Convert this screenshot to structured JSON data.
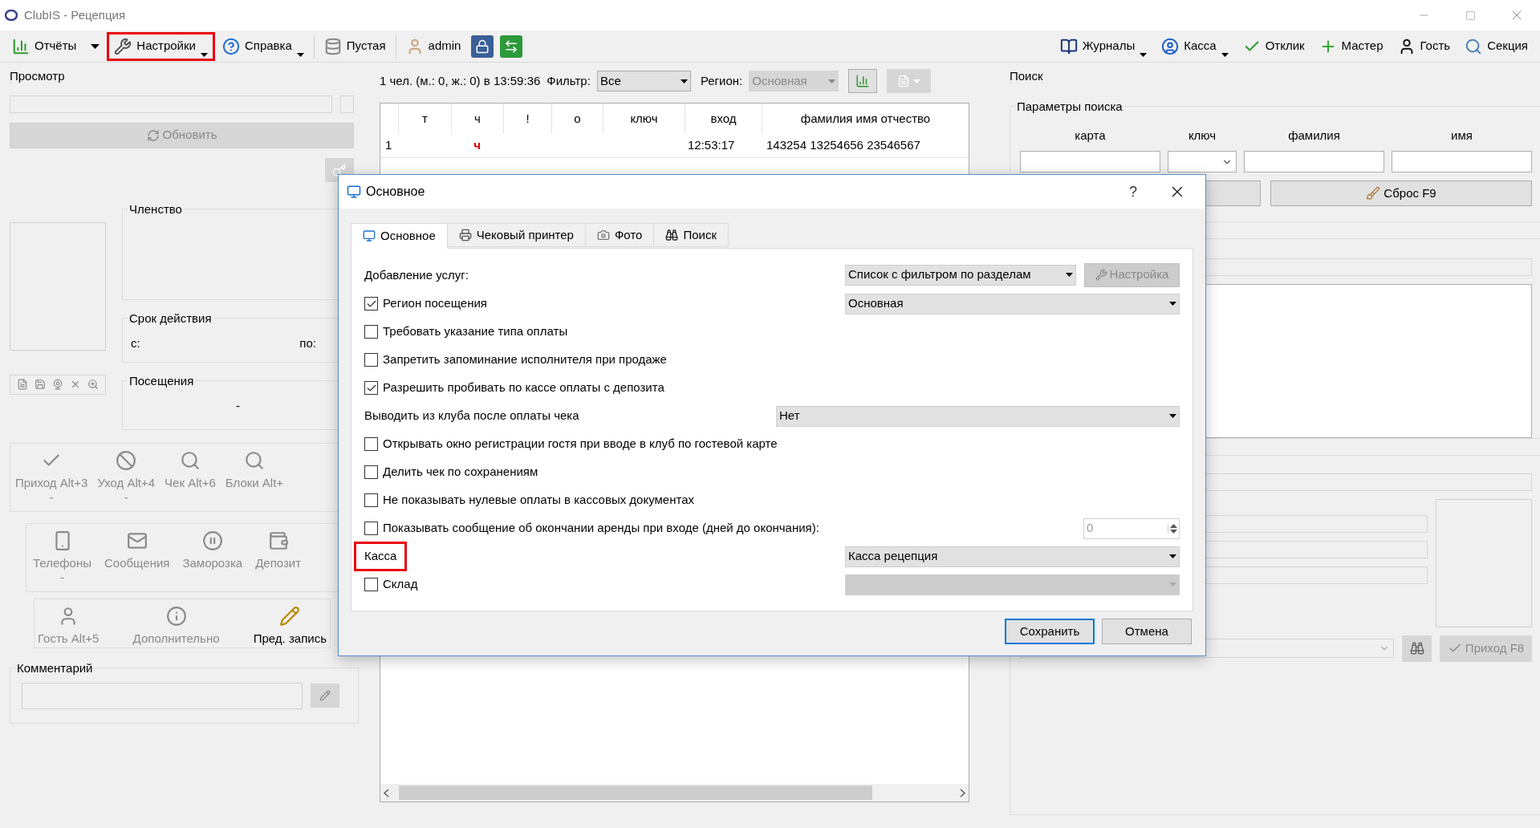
{
  "window": {
    "title": "ClubIS - Рецепция"
  },
  "toolbar_left": [
    {
      "label": "Отчёты",
      "kind": "split",
      "highlighted": false
    },
    {
      "label": "Настройки",
      "kind": "menu",
      "highlighted": true
    },
    {
      "label": "Справка",
      "kind": "menu",
      "highlighted": false
    },
    {
      "label": "Пустая",
      "kind": "plain",
      "highlighted": false
    },
    {
      "label": "admin",
      "kind": "plain",
      "highlighted": false
    }
  ],
  "toolbar_right": [
    {
      "label": "Журналы",
      "kind": "menu"
    },
    {
      "label": "Касса",
      "kind": "menu"
    },
    {
      "label": "Отклик",
      "kind": "plain"
    },
    {
      "label": "Мастер",
      "kind": "plain"
    },
    {
      "label": "Гость",
      "kind": "plain"
    },
    {
      "label": "Секция",
      "kind": "plain"
    }
  ],
  "view_panel": {
    "title": "Просмотр",
    "refresh_button": "Обновить",
    "membership_title": "Членство",
    "validity": {
      "title": "Срок действия",
      "from": "с:",
      "to": "по:"
    },
    "visits": {
      "title": "Посещения",
      "value": "-"
    },
    "actions_row1": [
      {
        "label": "Приход Alt+3",
        "sub": "-",
        "disabled": true
      },
      {
        "label": "Уход Alt+4",
        "sub": "-",
        "disabled": true
      },
      {
        "label": "Чек Alt+6",
        "disabled": true
      },
      {
        "label": "Блоки Alt+",
        "disabled": true
      }
    ],
    "actions_row2": [
      {
        "label": "Телефоны",
        "sub": "-",
        "disabled": true
      },
      {
        "label": "Сообщения",
        "disabled": true
      },
      {
        "label": "Заморозка",
        "disabled": true
      },
      {
        "label": "Депозит",
        "disabled": true
      }
    ],
    "actions_row3": [
      {
        "label": "Гость Alt+5",
        "disabled": true
      },
      {
        "label": "Дополнительно",
        "disabled": true
      },
      {
        "label": "Пред. запись",
        "disabled": false
      }
    ],
    "comment_title": "Комментарий"
  },
  "visitors": {
    "summary": "1 чел. (м.: 0, ж.: 0) в 13:59:36",
    "filter_label": "Фильтр:",
    "filter_value": "Все",
    "region_label": "Регион:",
    "region_value": "Основная",
    "columns": [
      "т",
      "ч",
      "!",
      "о",
      "ключ",
      "вход",
      "фамилия имя отчество"
    ],
    "rows": [
      {
        "index": "1",
        "column_2": "ч",
        "entry_time": "12:53:17",
        "full_name": "143254 13254656 23546567"
      }
    ]
  },
  "search_panel": {
    "title": "Поиск",
    "params_title": "Параметры поиска",
    "fields": [
      {
        "label": "карта",
        "kind": "input"
      },
      {
        "label": "ключ",
        "kind": "select"
      },
      {
        "label": "фамилия",
        "kind": "input"
      },
      {
        "label": "имя",
        "kind": "input"
      }
    ],
    "reset_button": "Сброс F9",
    "arrival_button": "Приход F8"
  },
  "dialog": {
    "title": "Основное",
    "help": "?",
    "tabs": [
      {
        "label": "Основное",
        "selected": true
      },
      {
        "label": "Чековый принтер",
        "selected": false
      },
      {
        "label": "Фото",
        "selected": false
      },
      {
        "label": "Поиск",
        "selected": false
      }
    ],
    "rows": [
      {
        "kind": "select",
        "label": "Добавление услуг:",
        "value": "Список с фильтром по разделам",
        "button": "Настройка"
      },
      {
        "kind": "checkbox_select",
        "label": "Регион посещения",
        "checked": true,
        "value": "Основная"
      },
      {
        "kind": "checkbox",
        "label": "Требовать указание типа оплаты",
        "checked": false
      },
      {
        "kind": "checkbox",
        "label": "Запретить запоминание исполнителя при продаже",
        "checked": false
      },
      {
        "kind": "checkbox",
        "label": "Разрешить пробивать по кассе оплаты с депозита",
        "checked": true
      },
      {
        "kind": "select_wide",
        "label": "Выводить из клуба после оплаты чека",
        "value": "Нет"
      },
      {
        "kind": "checkbox",
        "label": "Открывать окно регистрации гостя при вводе в клуб по гостевой карте",
        "checked": false
      },
      {
        "kind": "checkbox",
        "label": "Делить чек по сохранениям",
        "checked": false
      },
      {
        "kind": "checkbox",
        "label": "Не показывать нулевые оплаты в кассовых документах",
        "checked": false
      },
      {
        "kind": "checkbox_spin",
        "label": "Показывать сообщение об окончании аренды при входе (дней до окончания):",
        "checked": false,
        "value": "0"
      },
      {
        "kind": "select",
        "label": "Касса",
        "value": "Касса рецепция",
        "highlighted": true
      },
      {
        "kind": "checkbox_select",
        "label": "Склад",
        "checked": false,
        "select_disabled": true
      }
    ],
    "buttons": [
      {
        "label": "Сохранить",
        "default": true
      },
      {
        "label": "Отмена",
        "default": false
      }
    ]
  }
}
